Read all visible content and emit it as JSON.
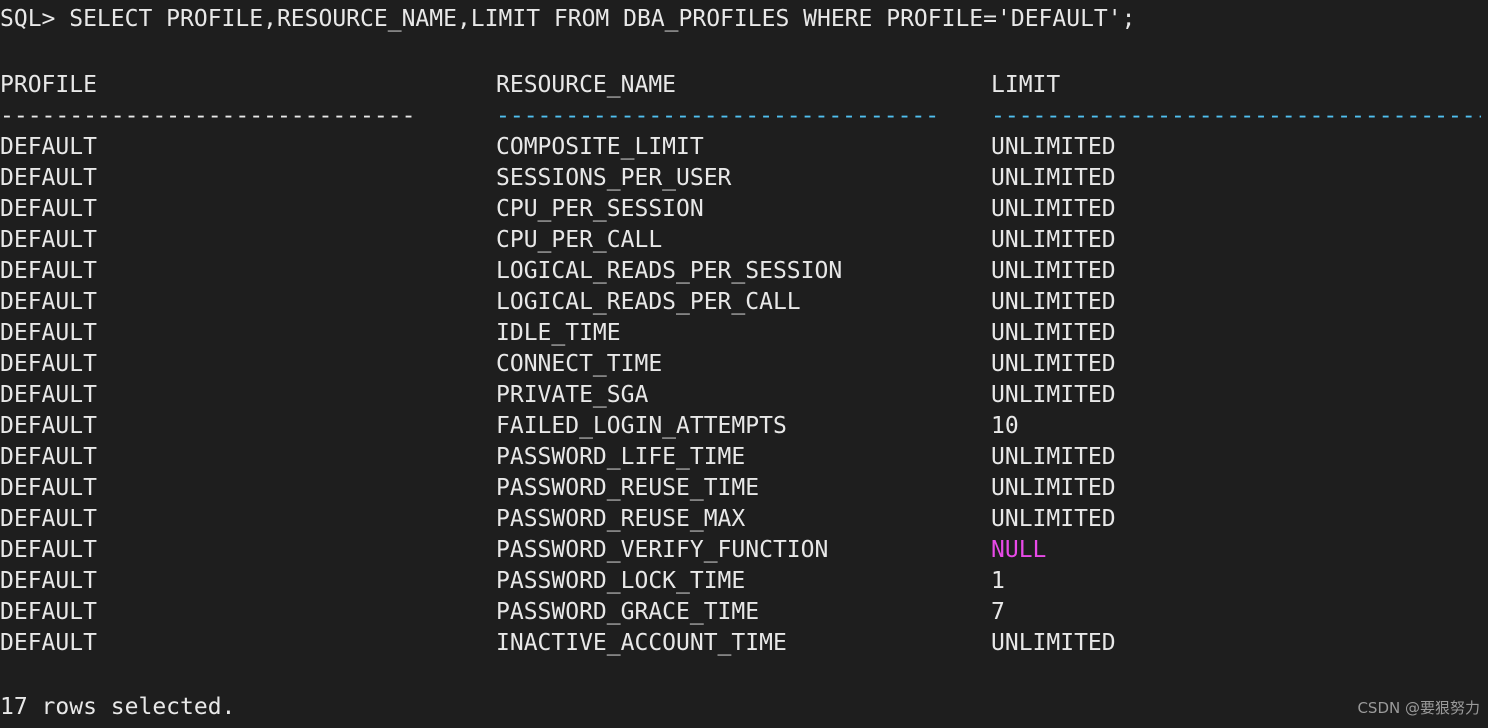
{
  "terminal": {
    "background_color": "#1e1e1e",
    "foreground_color": "#e8e8e8",
    "accent_cyan": "#50c0f0",
    "null_color": "#e84ae8",
    "watermark": "CSDN @要狠努力"
  },
  "prompt": {
    "label": "SQL>",
    "command": "SELECT PROFILE,RESOURCE_NAME,LIMIT FROM DBA_PROFILES WHERE PROFILE='DEFAULT';",
    "full_line": "SQL> SELECT PROFILE,RESOURCE_NAME,LIMIT FROM DBA_PROFILES WHERE PROFILE='DEFAULT';"
  },
  "table": {
    "headers": [
      "PROFILE",
      "RESOURCE_NAME",
      "LIMIT"
    ],
    "rules": [
      "------------------------------",
      "--------------------------------",
      "----------------------------------------",
      "--------"
    ],
    "rule_profile": "------------------------------",
    "rule_resource": "--------------------------------",
    "rule_limit": "----------------------------------------",
    "rows": [
      {
        "profile": "DEFAULT",
        "resource_name": "COMPOSITE_LIMIT",
        "limit": "UNLIMITED",
        "limit_is_null": false
      },
      {
        "profile": "DEFAULT",
        "resource_name": "SESSIONS_PER_USER",
        "limit": "UNLIMITED",
        "limit_is_null": false
      },
      {
        "profile": "DEFAULT",
        "resource_name": "CPU_PER_SESSION",
        "limit": "UNLIMITED",
        "limit_is_null": false
      },
      {
        "profile": "DEFAULT",
        "resource_name": "CPU_PER_CALL",
        "limit": "UNLIMITED",
        "limit_is_null": false
      },
      {
        "profile": "DEFAULT",
        "resource_name": "LOGICAL_READS_PER_SESSION",
        "limit": "UNLIMITED",
        "limit_is_null": false
      },
      {
        "profile": "DEFAULT",
        "resource_name": "LOGICAL_READS_PER_CALL",
        "limit": "UNLIMITED",
        "limit_is_null": false
      },
      {
        "profile": "DEFAULT",
        "resource_name": "IDLE_TIME",
        "limit": "UNLIMITED",
        "limit_is_null": false
      },
      {
        "profile": "DEFAULT",
        "resource_name": "CONNECT_TIME",
        "limit": "UNLIMITED",
        "limit_is_null": false
      },
      {
        "profile": "DEFAULT",
        "resource_name": "PRIVATE_SGA",
        "limit": "UNLIMITED",
        "limit_is_null": false
      },
      {
        "profile": "DEFAULT",
        "resource_name": "FAILED_LOGIN_ATTEMPTS",
        "limit": "10",
        "limit_is_null": false
      },
      {
        "profile": "DEFAULT",
        "resource_name": "PASSWORD_LIFE_TIME",
        "limit": "UNLIMITED",
        "limit_is_null": false
      },
      {
        "profile": "DEFAULT",
        "resource_name": "PASSWORD_REUSE_TIME",
        "limit": "UNLIMITED",
        "limit_is_null": false
      },
      {
        "profile": "DEFAULT",
        "resource_name": "PASSWORD_REUSE_MAX",
        "limit": "UNLIMITED",
        "limit_is_null": false
      },
      {
        "profile": "DEFAULT",
        "resource_name": "PASSWORD_VERIFY_FUNCTION",
        "limit": "NULL",
        "limit_is_null": true
      },
      {
        "profile": "DEFAULT",
        "resource_name": "PASSWORD_LOCK_TIME",
        "limit": "1",
        "limit_is_null": false
      },
      {
        "profile": "DEFAULT",
        "resource_name": "PASSWORD_GRACE_TIME",
        "limit": "7",
        "limit_is_null": false
      },
      {
        "profile": "DEFAULT",
        "resource_name": "INACTIVE_ACCOUNT_TIME",
        "limit": "UNLIMITED",
        "limit_is_null": false
      }
    ]
  },
  "status": {
    "rows_selected": "17 rows selected."
  }
}
